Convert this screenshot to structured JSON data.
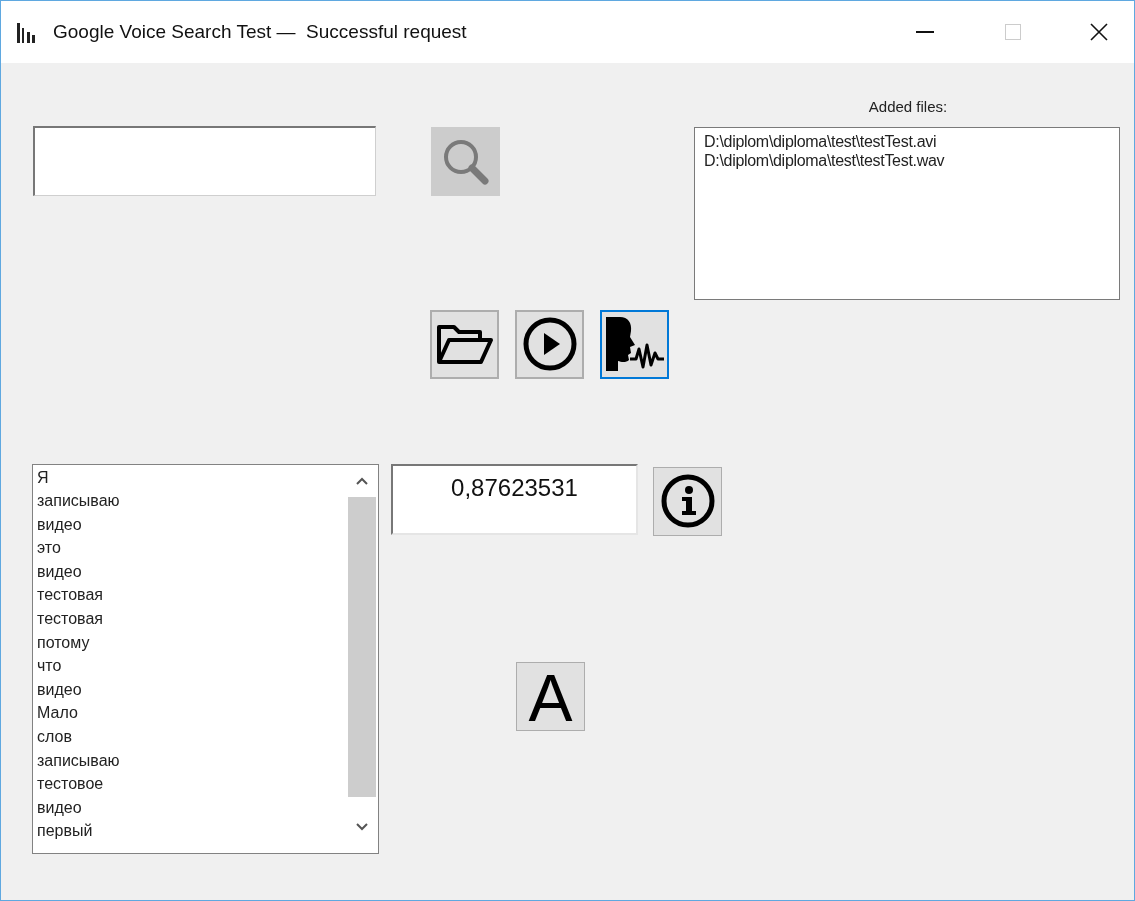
{
  "window": {
    "title": "Google Voice Search Test —  Successful request",
    "maximize_disabled": true
  },
  "search": {
    "disabled": true
  },
  "files": {
    "label": "Added files:",
    "items": [
      "D:\\diplom\\diploma\\test\\testTest.avi",
      "D:\\diplom\\diploma\\test\\testTest.wav"
    ]
  },
  "tools": [
    {
      "kind": "open",
      "focused": false
    },
    {
      "kind": "play",
      "focused": false
    },
    {
      "kind": "speech",
      "focused": true
    }
  ],
  "words": [
    "Я",
    "записываю",
    "видео",
    "это",
    "видео",
    "тестовая",
    "тестовая",
    "потому",
    "что",
    "видео",
    "Мало",
    "слов",
    "записываю",
    "тестовое",
    "видео",
    "первый"
  ],
  "score": "0,87623531",
  "font_button": {
    "label": "A"
  }
}
